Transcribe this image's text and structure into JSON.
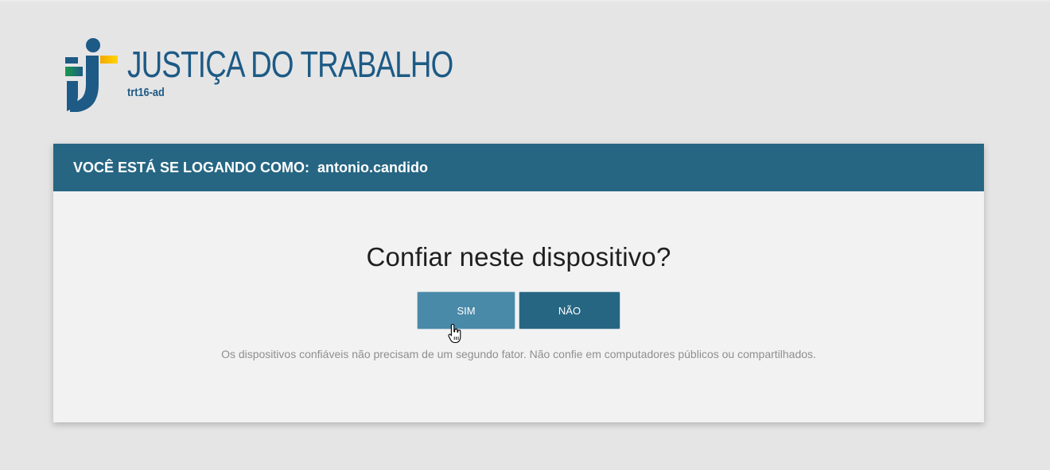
{
  "brand": {
    "title": "JUSTIÇA DO TRABALHO",
    "subtitle": "trt16-ad",
    "colors": {
      "blue": "#1d5a85",
      "green": "#2aa05a",
      "yellow": "#f5c400"
    }
  },
  "login": {
    "header_label": "VOCÊ ESTÁ SE LOGANDO COMO:",
    "username": "antonio.candido",
    "question": "Confiar neste dispositivo?",
    "yes_label": "SIM",
    "no_label": "NÃO",
    "note": "Os dispositivos confiáveis não precisam de um segundo fator. Não confie em computadores públicos ou compartilhados."
  },
  "colors": {
    "header_bg": "#266683",
    "yes_bg": "#4a8aa9",
    "no_bg": "#266683",
    "page_bg": "#e5e5e6",
    "card_bg": "#f2f2f2"
  },
  "cursor_icon": "hand-pointer-icon"
}
